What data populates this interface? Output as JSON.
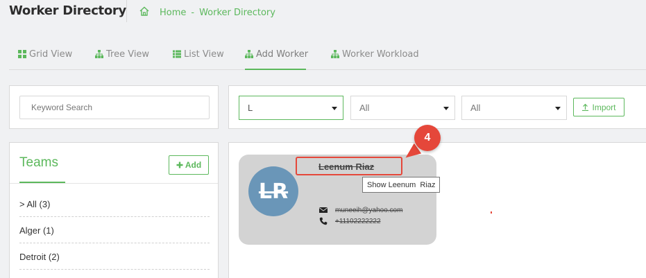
{
  "header": {
    "title": "Worker Directory",
    "breadcrumb": {
      "home": "Home",
      "separator": "-",
      "current": "Worker Directory"
    }
  },
  "tabs": [
    {
      "label": "Grid View",
      "icon": "grid-icon"
    },
    {
      "label": "Tree View",
      "icon": "sitemap-icon"
    },
    {
      "label": "List View",
      "icon": "list-icon"
    },
    {
      "label": "Add Worker",
      "icon": "sitemap-icon",
      "active": true
    },
    {
      "label": "Worker Workload",
      "icon": "sitemap-icon"
    }
  ],
  "search": {
    "placeholder": "Keyword Search",
    "value": ""
  },
  "filters": [
    {
      "value": "L"
    },
    {
      "value": "All"
    },
    {
      "value": "All"
    }
  ],
  "import_label": "Import",
  "teams": {
    "title": "Teams",
    "add_label": "Add",
    "items": [
      {
        "label": "> All (3)"
      },
      {
        "label": "Alger (1)"
      },
      {
        "label": "Detroit (2)"
      }
    ]
  },
  "worker": {
    "initials": "LR",
    "name": "Leenum Riaz",
    "email": "muneeih@yahoo.com",
    "phone": "+11102222222"
  },
  "tooltip": {
    "text": "Show Leenum  Riaz"
  },
  "annotation": {
    "number": "4"
  },
  "colors": {
    "accent": "#5cb85c",
    "avatar": "#6a96b8",
    "card": "#d3d3d3",
    "annotation": "#e5473a"
  }
}
